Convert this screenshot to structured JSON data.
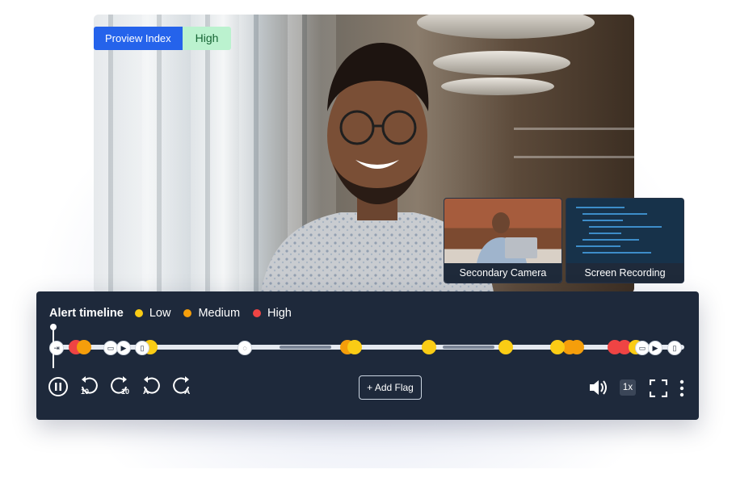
{
  "proview": {
    "label": "Proview Index",
    "value": "High"
  },
  "thumbnails": [
    {
      "caption": "Secondary Camera",
      "icon": "camera-feed"
    },
    {
      "caption": "Screen Recording",
      "icon": "screen-feed"
    }
  ],
  "timeline": {
    "title": "Alert timeline",
    "legend": [
      {
        "label": "Low",
        "color": "#facc15"
      },
      {
        "label": "Medium",
        "color": "#f59e0b"
      },
      {
        "label": "High",
        "color": "#ef4444"
      }
    ]
  },
  "controls": {
    "add_flag": "+ Add Flag",
    "speed": "1x",
    "rewind_10": "10",
    "forward_10": "10",
    "prev_alert": "A",
    "next_alert": "A"
  },
  "colors": {
    "panel": "#1e293b",
    "accent": "#2563eb",
    "badge_bg": "#bbf2cf"
  }
}
